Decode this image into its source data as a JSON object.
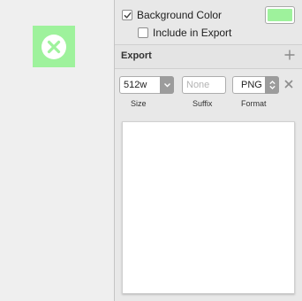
{
  "colors": {
    "artboard_background": "#9ef29c",
    "swatch_color": "#9ef29c",
    "stepper": "#9c9c9c"
  },
  "canvas": {
    "artboard_icon": "close-circle-icon"
  },
  "inspector": {
    "background_color": {
      "label": "Background Color",
      "checked": true
    },
    "include_in_export": {
      "label": "Include in Export",
      "checked": false
    },
    "export": {
      "title": "Export",
      "add_icon": "plus-icon",
      "size": {
        "value": "512w",
        "label": "Size"
      },
      "suffix": {
        "value": "",
        "placeholder": "None",
        "label": "Suffix"
      },
      "format": {
        "value": "PNG",
        "label": "Format"
      },
      "remove_icon": "close-icon"
    }
  }
}
